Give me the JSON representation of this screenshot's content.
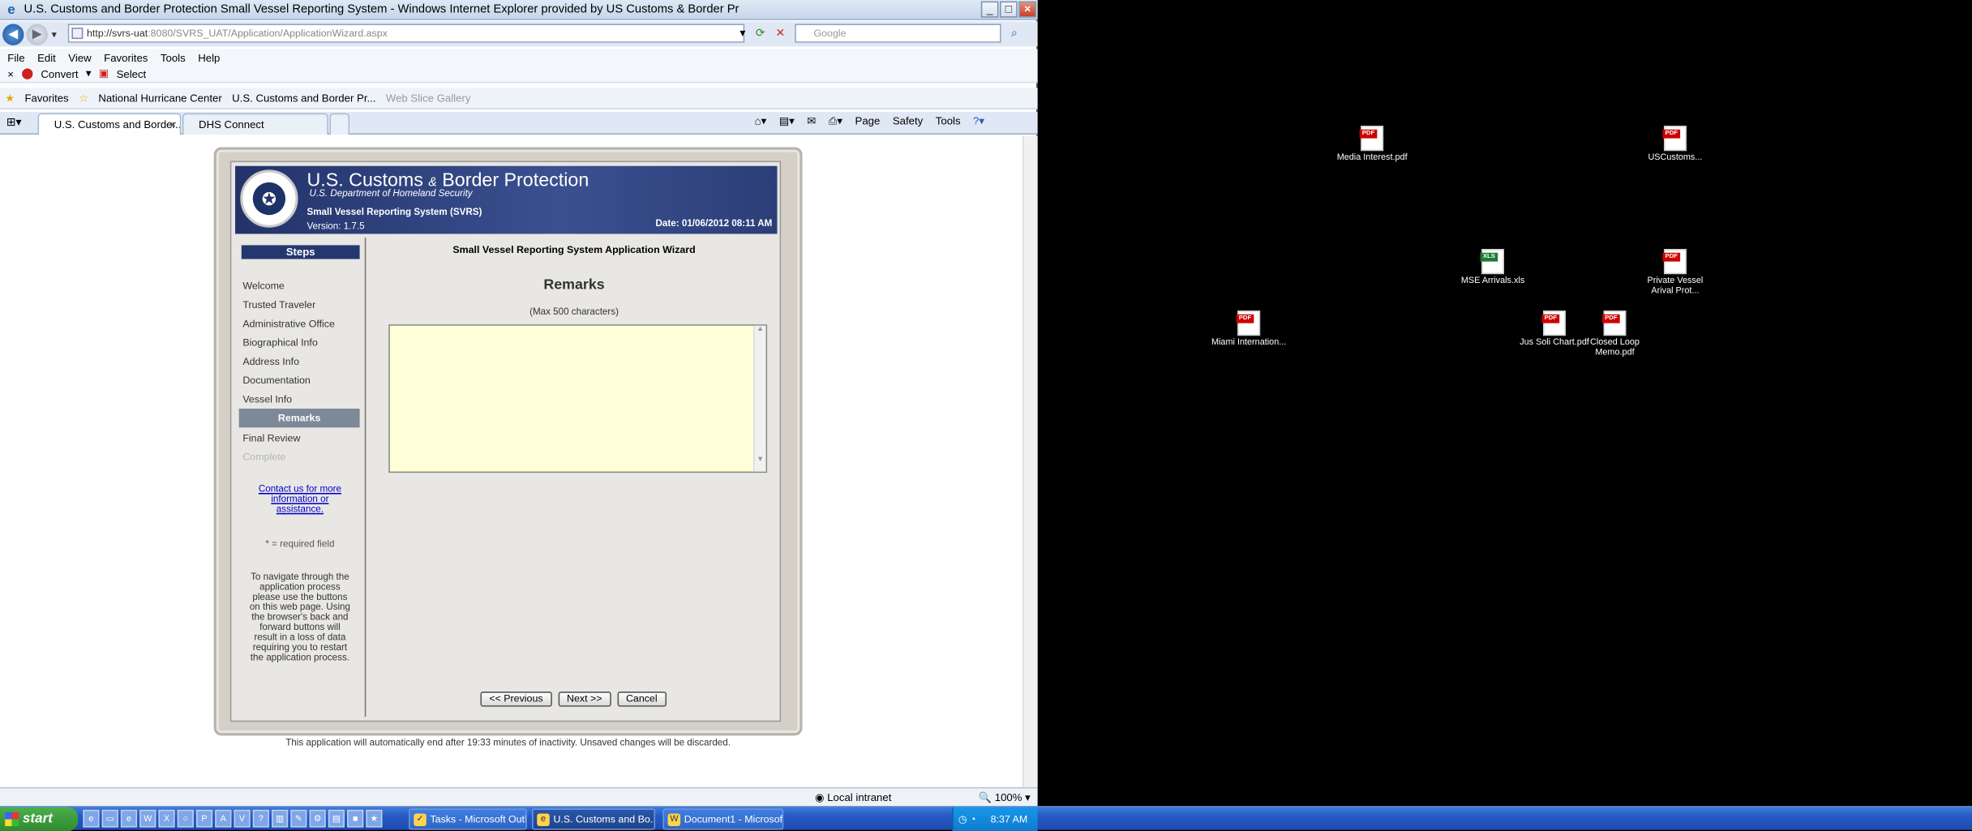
{
  "window": {
    "title": "U.S. Customs and Border Protection Small Vessel Reporting System - Windows Internet Explorer provided by US Customs & Border Pr",
    "url_host": "http://svrs-uat",
    "url_rest": ":8080/SVRS_UAT/Application/ApplicationWizard.aspx",
    "search_placeholder": "Google"
  },
  "menu": [
    "File",
    "Edit",
    "View",
    "Favorites",
    "Tools",
    "Help"
  ],
  "command": {
    "convert": "Convert",
    "select": "Select"
  },
  "favorites": {
    "label": "Favorites",
    "links": [
      "National Hurricane Center",
      "U.S. Customs and Border Pr...",
      "Web Slice Gallery"
    ]
  },
  "tabs": [
    {
      "label": "U.S. Customs and Border..."
    },
    {
      "label": "DHS Connect"
    }
  ],
  "ie_tools": [
    "Page",
    "Safety",
    "Tools"
  ],
  "banner": {
    "agency": "U.S. Customs",
    "amp": "&",
    "agency2": "Border Protection",
    "dept": "U.S. Department of Homeland Security",
    "system": "Small Vessel Reporting System (SVRS)",
    "version": "Version: 1.7.5",
    "date": "Date: 01/06/2012 08:11 AM"
  },
  "steps": {
    "header": "Steps",
    "items": [
      "Welcome",
      "Trusted Traveler",
      "Administrative Office",
      "Biographical Info",
      "Address Info",
      "Documentation",
      "Vessel Info",
      "Remarks",
      "Final Review",
      "Complete"
    ],
    "current_index": 7,
    "contact_link": "Contact us for more information or assistance.",
    "required_note": "* = required field",
    "nav_note": "To navigate through the application process please use the buttons on this web page. Using the browser's back and forward buttons will result in a loss of data requiring you to restart the application process."
  },
  "main": {
    "wizard_title": "Small Vessel Reporting System Application Wizard",
    "section_title": "Remarks",
    "max_note": "(Max 500 characters)",
    "remarks_value": ""
  },
  "buttons": {
    "previous": "<< Previous",
    "next": "Next >>",
    "cancel": "Cancel"
  },
  "timeout_note": "This application will automatically end after 19:33 minutes of inactivity. Unsaved changes will be discarded.",
  "statusbar": {
    "zone": "Local intranet",
    "zoom": "100%"
  },
  "desktop_icons": [
    {
      "label": "Media Interest.pdf",
      "type": "pdf"
    },
    {
      "label": "USCustoms...",
      "type": "pdf"
    },
    {
      "label": "MSE Arrivals.xls",
      "type": "xls"
    },
    {
      "label": "Private Vessel Arival Prot...",
      "type": "pdf"
    },
    {
      "label": "Miami Internation...",
      "type": "pdf"
    },
    {
      "label": "Jus Soli Chart.pdf",
      "type": "pdf"
    },
    {
      "label": "Closed Loop Memo.pdf",
      "type": "pdf"
    }
  ],
  "taskbar": {
    "start": "start",
    "windows": [
      "Tasks - Microsoft Outl...",
      "U.S. Customs and Bo...",
      "Document1 - Microsof..."
    ],
    "clock": "8:37 AM"
  }
}
